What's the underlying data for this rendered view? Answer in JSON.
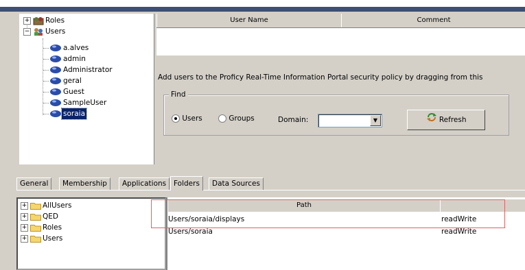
{
  "user_tree": {
    "roles_label": "Roles",
    "users_label": "Users",
    "users": [
      "a.alves",
      "admin",
      "Administrator",
      "geral",
      "Guest",
      "SampleUser",
      "soraia"
    ]
  },
  "users_grid": {
    "columns": [
      "User Name",
      "Comment"
    ]
  },
  "instruction": "Add users to the Proficy Real-Time Information Portal security policy by dragging from this",
  "find": {
    "legend": "Find",
    "radio_users": "Users",
    "radio_groups": "Groups",
    "domain_label": "Domain:",
    "domain_value": "",
    "refresh_label": "Refresh"
  },
  "tabs": [
    "General",
    "Membership",
    "Applications",
    "Folders",
    "Data Sources"
  ],
  "active_tab": "Folders",
  "folder_tree": [
    "AllUsers",
    "QED",
    "Roles",
    "Users"
  ],
  "path_grid": {
    "columns": [
      "Path",
      ""
    ],
    "rows": [
      {
        "path": "Users/soraia/displays",
        "access": "readWrite"
      },
      {
        "path": "Users/soraia",
        "access": "readWrite"
      }
    ]
  },
  "colors": {
    "title_bar": "#3d4f74",
    "selection": "#0a246a",
    "highlight_box": "#e06060"
  },
  "icons": [
    "roles-icon",
    "users-group-icon",
    "user-icon",
    "folder-icon",
    "refresh-icon",
    "chevron-down-icon"
  ]
}
